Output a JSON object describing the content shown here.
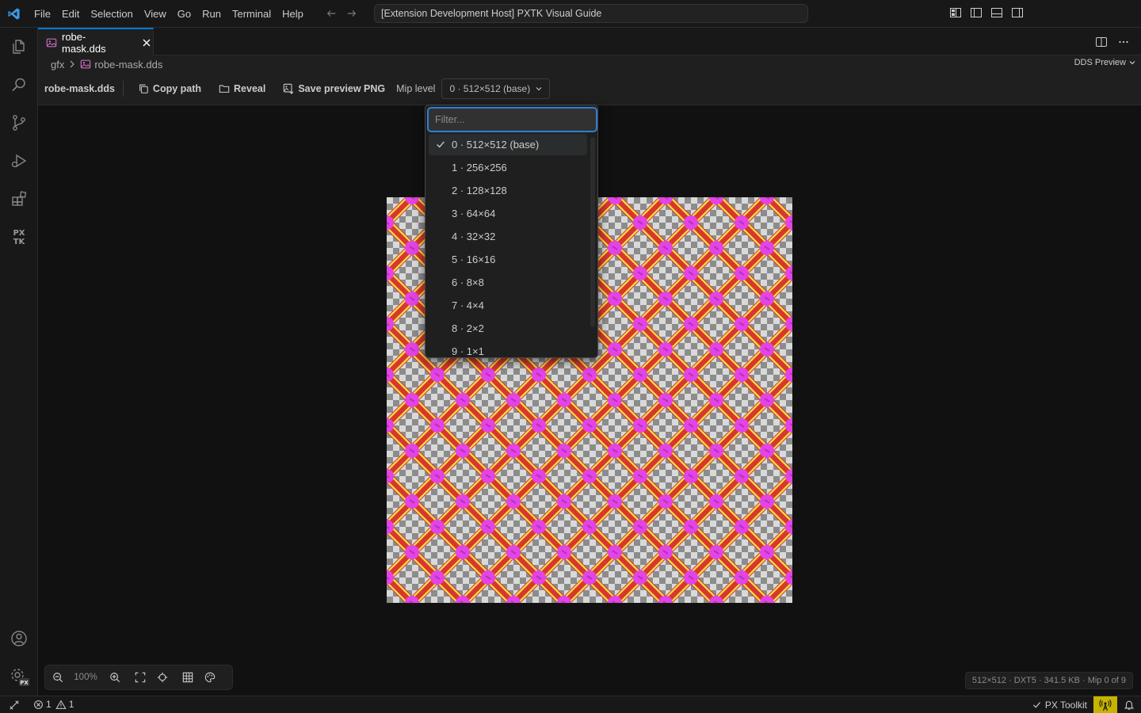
{
  "titlebar": {
    "menu": [
      "File",
      "Edit",
      "Selection",
      "View",
      "Go",
      "Run",
      "Terminal",
      "Help"
    ],
    "command_center": "[Extension Development Host] PXTK Visual Guide"
  },
  "activitybar": {
    "items": [
      "explorer-icon",
      "search-icon",
      "source-control-icon",
      "run-debug-icon",
      "extensions-icon",
      "pxtk-icon"
    ],
    "pxtk_logo": "PX\nTK",
    "settings_badge": "PX"
  },
  "tabs": [
    {
      "label": "robe-mask.dds",
      "active": true
    }
  ],
  "breadcrumb": {
    "folder": "gfx",
    "file": "robe-mask.dds",
    "view_mode": "DDS Preview"
  },
  "toolbar": {
    "file_name": "robe-mask.dds",
    "copy_path": "Copy path",
    "reveal": "Reveal",
    "save_png": "Save preview PNG",
    "mip_label": "Mip level",
    "mip_value": "0 · 512×512 (base)"
  },
  "dropdown": {
    "placeholder": "Filter...",
    "selected_index": 0,
    "options": [
      "0 · 512×512 (base)",
      "1 · 256×256",
      "2 · 128×128",
      "3 · 64×64",
      "4 · 32×32",
      "5 · 16×16",
      "6 · 8×8",
      "7 · 4×4",
      "8 · 2×2",
      "9 · 1×1"
    ]
  },
  "zoom": {
    "value": "100%"
  },
  "info_badge": "512×512 · DXT5 · 341.5 KB · Mip 0 of 9",
  "statusbar": {
    "errors": "1",
    "warnings": "1",
    "px_toolkit": "PX Toolkit"
  },
  "colors": {
    "accent": "#0078d4",
    "texture_red": "#d9372c",
    "texture_yellow": "#f3e24a",
    "texture_magenta": "#e244e6",
    "status_radio": "#c7b400"
  }
}
